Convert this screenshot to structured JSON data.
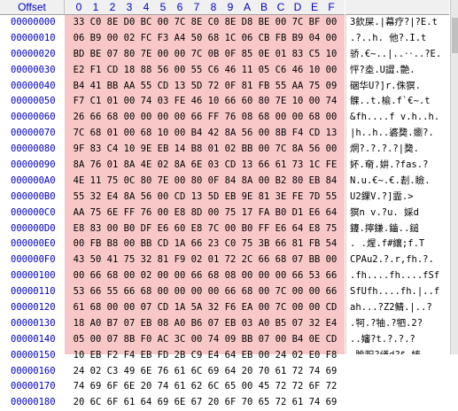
{
  "header": {
    "offset_label": "Offset",
    "columns": [
      "0",
      "1",
      "2",
      "3",
      "4",
      "5",
      "6",
      "7",
      "8",
      "9",
      "A",
      "B",
      "C",
      "D",
      "E",
      "F"
    ]
  },
  "rows": [
    {
      "offset": "00000000",
      "hex": [
        "33",
        "C0",
        "8E",
        "D0",
        "BC",
        "00",
        "7C",
        "8E",
        "C0",
        "8E",
        "D8",
        "BE",
        "00",
        "7C",
        "BF",
        "00"
      ],
      "ascii": "3欽屎.|幕疗?|?E.t"
    },
    {
      "offset": "00000010",
      "hex": [
        "06",
        "B9",
        "00",
        "02",
        "FC",
        "F3",
        "A4",
        "50",
        "68",
        "1C",
        "06",
        "CB",
        "FB",
        "B9",
        "04",
        "00"
      ],
      "ascii": ".?..h. 他?.I.t"
    },
    {
      "offset": "00000020",
      "hex": [
        "BD",
        "BE",
        "07",
        "80",
        "7E",
        "00",
        "00",
        "7C",
        "0B",
        "0F",
        "85",
        "0E",
        "01",
        "83",
        "C5",
        "10"
      ],
      "ascii": "骄.€~..|..‥..?E."
    },
    {
      "offset": "00000030",
      "hex": [
        "E2",
        "F1",
        "CD",
        "18",
        "88",
        "56",
        "00",
        "55",
        "C6",
        "46",
        "11",
        "05",
        "C6",
        "46",
        "10",
        "00"
      ],
      "ascii": "怦?坴.U譅.艶."
    },
    {
      "offset": "00000040",
      "hex": [
        "B4",
        "41",
        "BB",
        "AA",
        "55",
        "CD",
        "13",
        "5D",
        "72",
        "0F",
        "81",
        "FB",
        "55",
        "AA",
        "75",
        "09"
      ],
      "ascii": "碅华U?]r.侏猽."
    },
    {
      "offset": "00000050",
      "hex": [
        "F7",
        "C1",
        "01",
        "00",
        "74",
        "03",
        "FE",
        "46",
        "10",
        "66",
        "60",
        "80",
        "7E",
        "10",
        "00",
        "74"
      ],
      "ascii": "髁..t.榆.f`€~.t"
    },
    {
      "offset": "00000060",
      "hex": [
        "26",
        "66",
        "68",
        "00",
        "00",
        "00",
        "00",
        "66",
        "FF",
        "76",
        "08",
        "68",
        "00",
        "00",
        "68",
        "00"
      ],
      "ascii": "&fh....f v.h..h."
    },
    {
      "offset": "00000070",
      "hex": [
        "7C",
        "68",
        "01",
        "00",
        "68",
        "10",
        "00",
        "B4",
        "42",
        "8A",
        "56",
        "00",
        "8B",
        "F4",
        "CD",
        "13"
      ],
      "ascii": "|h..h..碆奦.嬼?."
    },
    {
      "offset": "00000080",
      "hex": [
        "9F",
        "83",
        "C4",
        "10",
        "9E",
        "EB",
        "14",
        "B8",
        "01",
        "02",
        "BB",
        "00",
        "7C",
        "8A",
        "56",
        "00"
      ],
      "ascii": "焹?.?.?.?|奦."
    },
    {
      "offset": "00000090",
      "hex": [
        "8A",
        "76",
        "01",
        "8A",
        "4E",
        "02",
        "8A",
        "6E",
        "03",
        "CD",
        "13",
        "66",
        "61",
        "73",
        "1C",
        "FE"
      ],
      "ascii": "妚.奛.妌.?fas.?"
    },
    {
      "offset": "000000A0",
      "hex": [
        "4E",
        "11",
        "75",
        "0C",
        "80",
        "7E",
        "00",
        "80",
        "0F",
        "84",
        "8A",
        "00",
        "B2",
        "80",
        "EB",
        "84"
      ],
      "ascii": "N.u.€~.€.剨.瞼."
    },
    {
      "offset": "000000B0",
      "hex": [
        "55",
        "32",
        "E4",
        "8A",
        "56",
        "00",
        "CD",
        "13",
        "5D",
        "EB",
        "9E",
        "81",
        "3E",
        "FE",
        "7D",
        "55"
      ],
      "ascii": "U2錁V.?]霝.>"
    },
    {
      "offset": "000000C0",
      "hex": [
        "AA",
        "75",
        "6E",
        "FF",
        "76",
        "00",
        "E8",
        "8D",
        "00",
        "75",
        "17",
        "FA",
        "B0",
        "D1",
        "E6",
        "64"
      ],
      "ascii": "猽n v.?u. 婇d"
    },
    {
      "offset": "000000D0",
      "hex": [
        "E8",
        "83",
        "00",
        "B0",
        "DF",
        "E6",
        "60",
        "E8",
        "7C",
        "00",
        "B0",
        "FF",
        "E6",
        "64",
        "E8",
        "75"
      ],
      "ascii": "鑳.擰鎌.鑡..鎚"
    },
    {
      "offset": "000000E0",
      "hex": [
        "00",
        "FB",
        "B8",
        "00",
        "BB",
        "CD",
        "1A",
        "66",
        "23",
        "C0",
        "75",
        "3B",
        "66",
        "81",
        "FB",
        "54"
      ],
      "ascii": ". .煋.f#纕;f.T"
    },
    {
      "offset": "000000F0",
      "hex": [
        "43",
        "50",
        "41",
        "75",
        "32",
        "81",
        "F9",
        "02",
        "01",
        "72",
        "2C",
        "66",
        "68",
        "07",
        "BB",
        "00"
      ],
      "ascii": "CPAu2.?.r,fh.?."
    },
    {
      "offset": "00000100",
      "hex": [
        "00",
        "66",
        "68",
        "00",
        "02",
        "00",
        "00",
        "66",
        "68",
        "08",
        "00",
        "00",
        "00",
        "66",
        "53",
        "66"
      ],
      "ascii": ".fh....fh....fSf"
    },
    {
      "offset": "00000110",
      "hex": [
        "53",
        "66",
        "55",
        "66",
        "68",
        "00",
        "00",
        "00",
        "00",
        "66",
        "68",
        "00",
        "7C",
        "00",
        "00",
        "66"
      ],
      "ascii": "SfUfh....fh.|..f"
    },
    {
      "offset": "00000120",
      "hex": [
        "61",
        "68",
        "00",
        "00",
        "07",
        "CD",
        "1A",
        "5A",
        "32",
        "F6",
        "EA",
        "00",
        "7C",
        "00",
        "00",
        "CD"
      ],
      "ascii": "ah...?Z2鲭.|..?"
    },
    {
      "offset": "00000130",
      "hex": [
        "18",
        "A0",
        "B7",
        "07",
        "EB",
        "08",
        "A0",
        "B6",
        "07",
        "EB",
        "03",
        "A0",
        "B5",
        "07",
        "32",
        "E4"
      ],
      "ascii": ".牱.?牰.?牭.2?"
    },
    {
      "offset": "00000140",
      "hex": [
        "05",
        "00",
        "07",
        "8B",
        "F0",
        "AC",
        "3C",
        "00",
        "74",
        "09",
        "BB",
        "07",
        "00",
        "B4",
        "0E",
        "CD"
      ],
      "ascii": "..嬸?t.?.?.?"
    },
    {
      "offset": "00000150",
      "hex": [
        "10",
        "EB",
        "F2",
        "F4",
        "EB",
        "FD",
        "2B",
        "C9",
        "E4",
        "64",
        "EB",
        "00",
        "24",
        "02",
        "E0",
        "F8"
      ],
      "ascii": ".腧贶?缮d?$.帱"
    },
    {
      "offset": "00000160",
      "hex": [
        "24",
        "02",
        "C3",
        "49",
        "6E",
        "76",
        "61",
        "6C",
        "69",
        "64",
        "20",
        "70",
        "61",
        "72",
        "74",
        "69"
      ],
      "ascii": "$.肗nvalid parti"
    },
    {
      "offset": "00000170",
      "hex": [
        "74",
        "69",
        "6F",
        "6E",
        "20",
        "74",
        "61",
        "62",
        "6C",
        "65",
        "00",
        "45",
        "72",
        "72",
        "6F",
        "72"
      ],
      "ascii": "tion table.Error"
    },
    {
      "offset": "00000180",
      "hex": [
        "20",
        "6C",
        "6F",
        "61",
        "64",
        "69",
        "6E",
        "67",
        "20",
        "6F",
        "70",
        "65",
        "72",
        "61",
        "74",
        "69"
      ],
      "ascii": " loading operati"
    }
  ]
}
